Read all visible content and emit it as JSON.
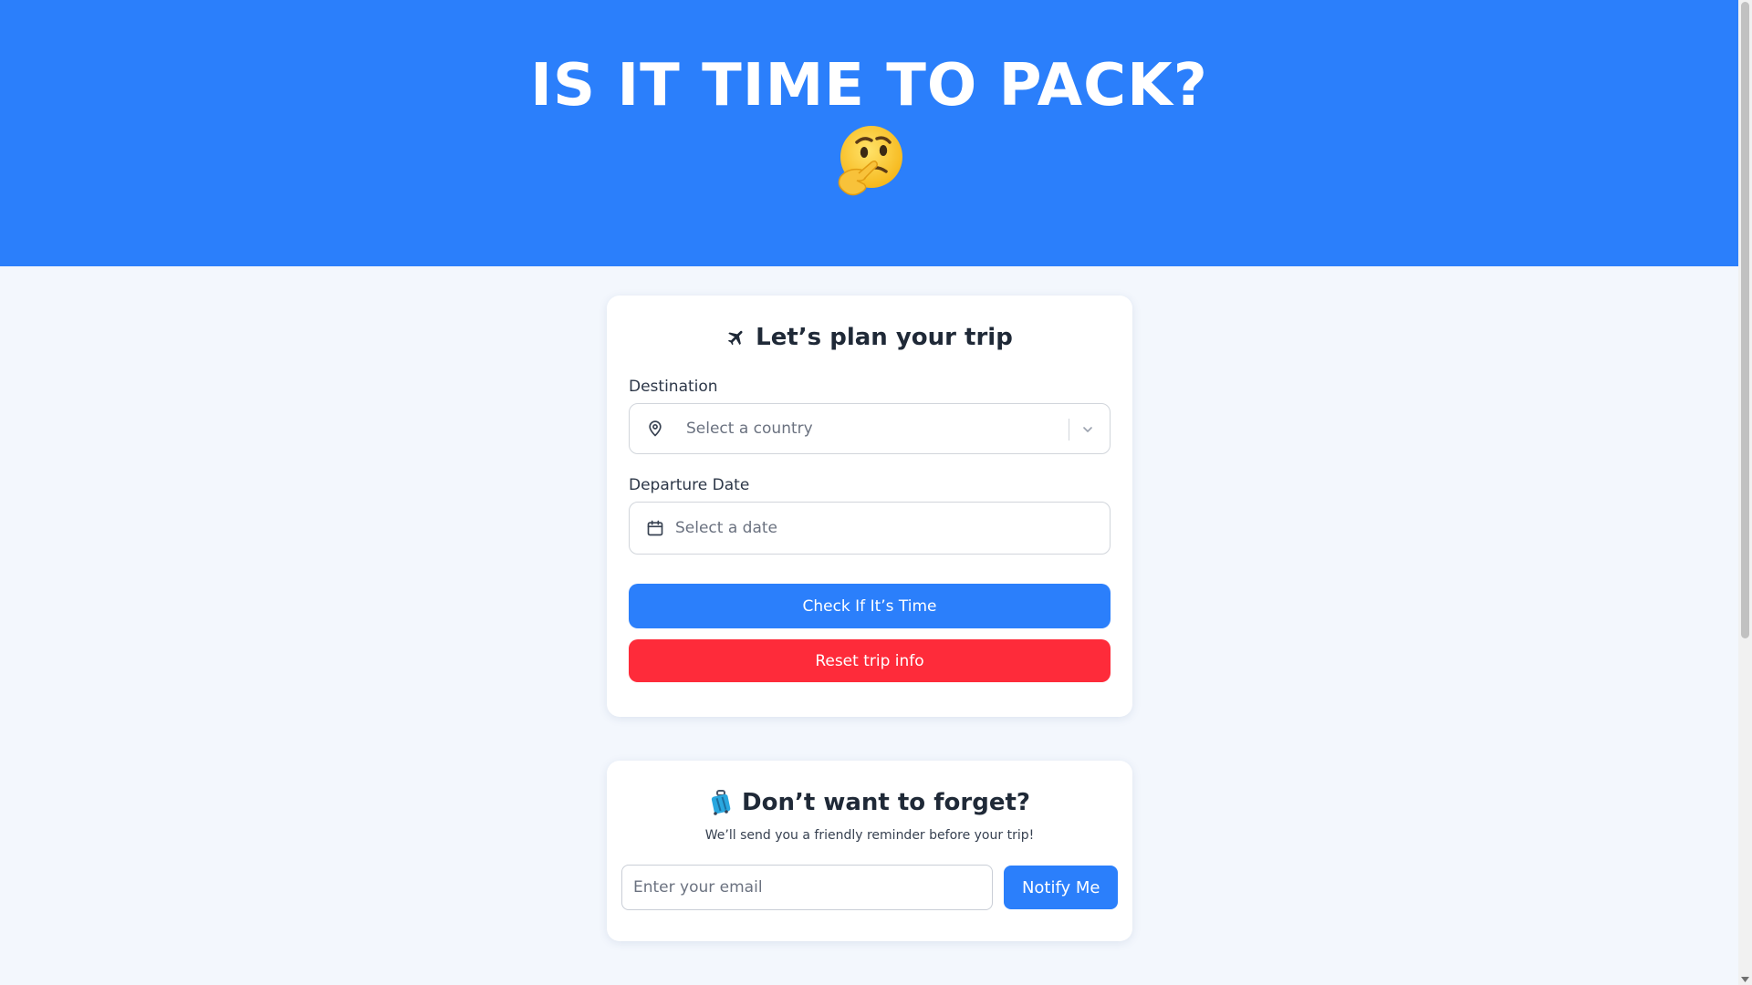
{
  "hero": {
    "title": "IS IT TIME TO PACK?",
    "emoji_icon": "thinking-face-icon"
  },
  "trip_card": {
    "title_icon": "airplane-icon",
    "title": "Let’s plan your trip",
    "destination": {
      "label": "Destination",
      "placeholder": "Select a country",
      "icon": "map-pin-icon"
    },
    "departure": {
      "label": "Departure Date",
      "placeholder": "Select a date",
      "icon": "calendar-icon"
    },
    "check_button": "Check If It’s Time",
    "reset_button": "Reset trip info"
  },
  "reminder_card": {
    "title_icon": "luggage-icon",
    "title": "Don’t want to forget?",
    "subtitle": "We’ll send you a friendly reminder before your trip!",
    "email_placeholder": "Enter your email",
    "notify_button": "Notify Me"
  },
  "colors": {
    "primary": "#2b7ffb",
    "danger": "#fe2b3a",
    "background": "#f3f7fd",
    "card": "#ffffff"
  }
}
